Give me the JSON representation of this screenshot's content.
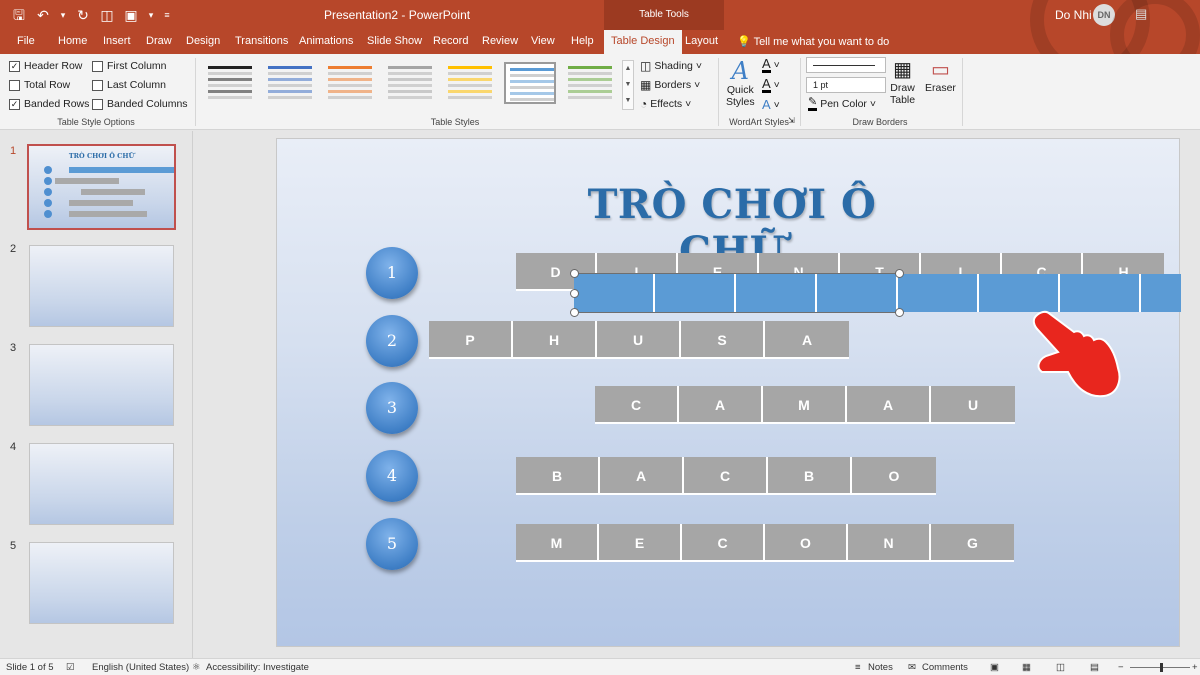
{
  "titlebar": {
    "doc_title": "Presentation2 - PowerPoint",
    "context_tab": "Table Tools",
    "user_name": "Do Nhi",
    "user_initials": "DN"
  },
  "tabs": [
    "File",
    "Home",
    "Insert",
    "Draw",
    "Design",
    "Transitions",
    "Animations",
    "Slide Show",
    "Record",
    "Review",
    "View",
    "Help",
    "Table Design",
    "Layout"
  ],
  "active_tab": "Table Design",
  "tell_me": "Tell me what you want to do",
  "ribbon": {
    "style_options": {
      "header_row": "Header Row",
      "total_row": "Total Row",
      "banded_rows": "Banded Rows",
      "first_column": "First Column",
      "last_column": "Last Column",
      "banded_columns": "Banded Columns",
      "label": "Table Style Options"
    },
    "table_styles": {
      "label": "Table Styles",
      "swatch_colors": [
        "#222222",
        "#4472c4",
        "#ed7d31",
        "#a5a5a5",
        "#ffc000",
        "#5b9bd5",
        "#70ad47"
      ],
      "selected_index": 5,
      "shading": "Shading",
      "borders": "Borders",
      "effects": "Effects"
    },
    "wordart": {
      "quick_styles_1": "Quick",
      "quick_styles_2": "Styles",
      "label": "WordArt Styles"
    },
    "draw_borders": {
      "pen_weight": "1 pt",
      "pen_color": "Pen Color",
      "draw_table_1": "Draw",
      "draw_table_2": "Table",
      "eraser": "Eraser",
      "label": "Draw Borders"
    }
  },
  "thumbnails": [
    "1",
    "2",
    "3",
    "4",
    "5"
  ],
  "slide": {
    "title": "TRÒ CHƠI Ô CHỮ",
    "rows": [
      {
        "num": "1",
        "letters": [
          "D",
          "I",
          "E",
          "N",
          "T",
          "I",
          "C",
          "H"
        ]
      },
      {
        "num": "2",
        "letters": [
          "P",
          "H",
          "U",
          "S",
          "A"
        ]
      },
      {
        "num": "3",
        "letters": [
          "C",
          "A",
          "M",
          "A",
          "U"
        ]
      },
      {
        "num": "4",
        "letters": [
          "B",
          "A",
          "C",
          "B",
          "O"
        ]
      },
      {
        "num": "5",
        "letters": [
          "M",
          "E",
          "C",
          "O",
          "N",
          "G"
        ]
      }
    ]
  },
  "status": {
    "slide_info": "Slide 1 of 5",
    "language": "English (United States)",
    "accessibility": "Accessibility: Investigate",
    "notes": "Notes",
    "comments": "Comments"
  }
}
